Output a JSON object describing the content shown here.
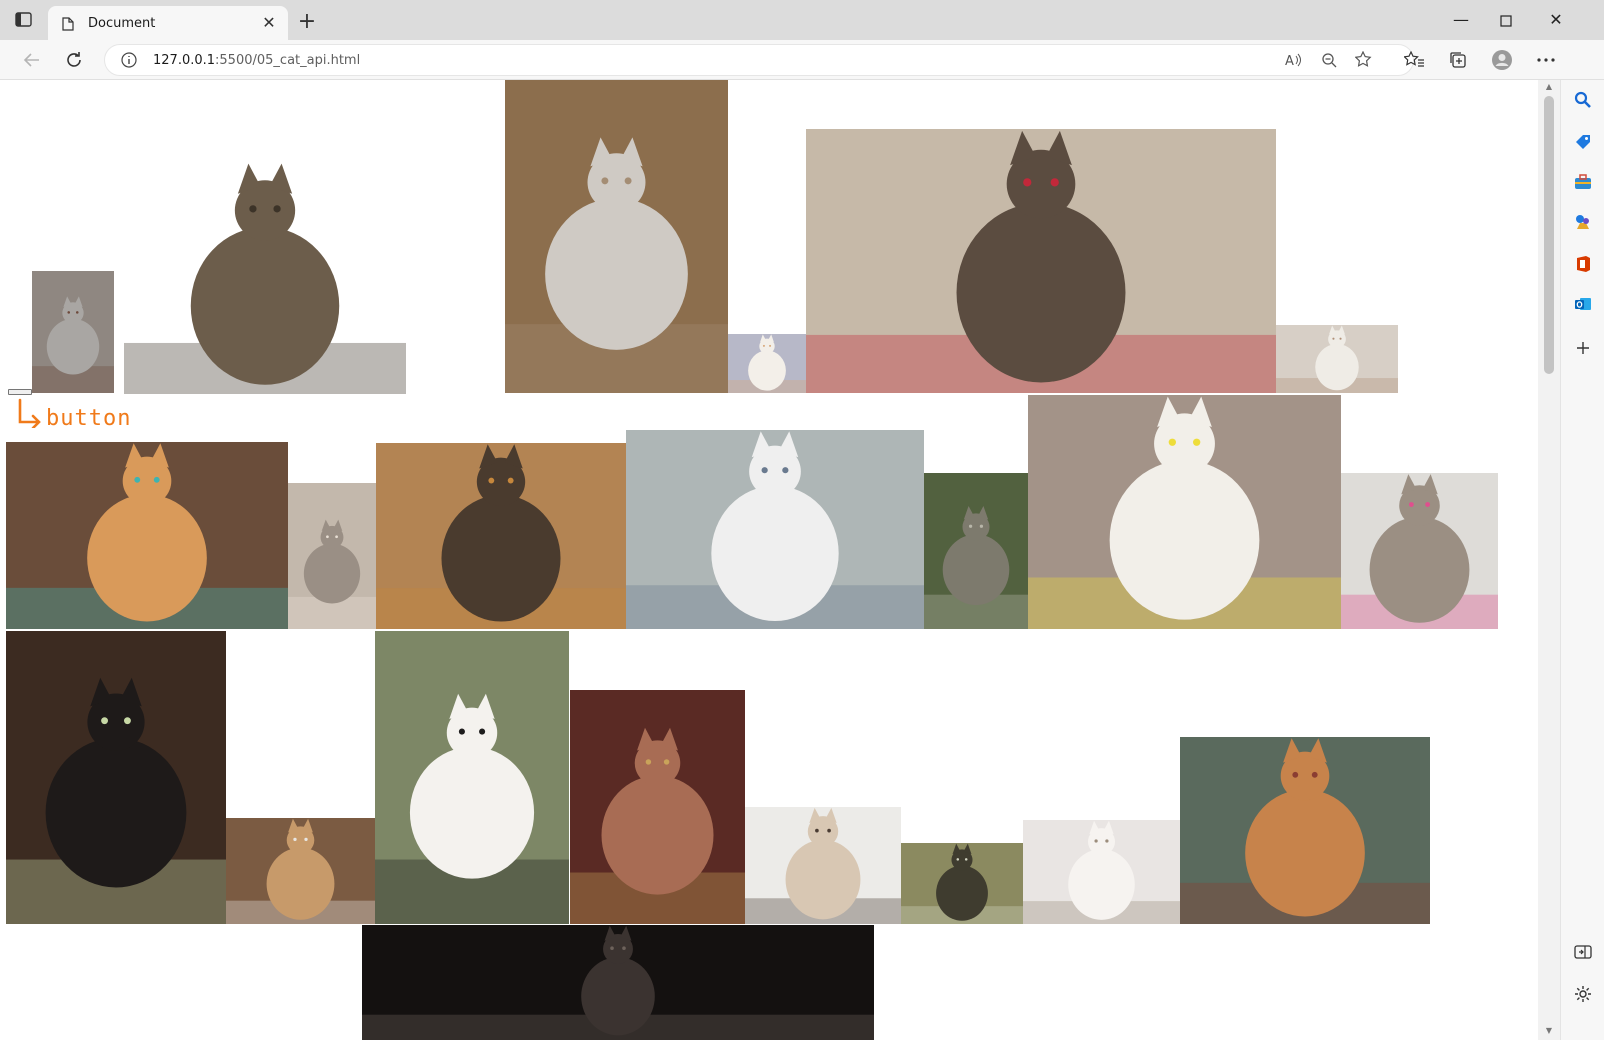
{
  "browser": {
    "tab_title": "Document",
    "url_host": "127.0.0.1",
    "url_path": ":5500/05_cat_api.html"
  },
  "page": {
    "button_annotation": "button",
    "annotation_color": "#f07a1a"
  },
  "cats": [
    {
      "name": "cat-photo-kitten-grey",
      "bg": "#8f8781",
      "body": "#a9a6a3",
      "accent": "#6e4a3c"
    },
    {
      "name": "cat-photo-tabby-sitting",
      "bg": "#ffffff",
      "body": "#6c5d4b",
      "accent": "#3c3328"
    },
    {
      "name": "cat-photo-fluffy-grey",
      "bg": "#8c6e4d",
      "body": "#cfcac4",
      "accent": "#a48d74"
    },
    {
      "name": "cat-photo-small-white",
      "bg": "#b7b8c8",
      "body": "#f3efe9",
      "accent": "#d7a77a"
    },
    {
      "name": "cat-photo-curly-brown",
      "bg": "#c6b9a8",
      "body": "#5b4c40",
      "accent": "#c2283a"
    },
    {
      "name": "cat-photo-room-small",
      "bg": "#d7cfc6",
      "body": "#efece6",
      "accent": "#b09078"
    },
    {
      "name": "cat-photo-orange-basket",
      "bg": "#6a4d3a",
      "body": "#d99a5a",
      "accent": "#3fb3b0"
    },
    {
      "name": "cat-photo-grey-floor",
      "bg": "#c3b8ac",
      "body": "#9a8f85",
      "accent": "#e7ded3"
    },
    {
      "name": "cat-photo-breadbox",
      "bg": "#b38453",
      "body": "#4a3b2e",
      "accent": "#c6873c"
    },
    {
      "name": "cat-photo-pillow",
      "bg": "#aeb6b6",
      "body": "#efefef",
      "accent": "#6a7a8f"
    },
    {
      "name": "cat-photo-tree",
      "bg": "#52613f",
      "body": "#7d7a6d",
      "accent": "#b8b6a9"
    },
    {
      "name": "cat-photo-fluffy-sleeping",
      "bg": "#a39388",
      "body": "#f2efe9",
      "accent": "#eedd3a"
    },
    {
      "name": "cat-photo-party",
      "bg": "#dedcd8",
      "body": "#9b8f83",
      "accent": "#e04f8e"
    },
    {
      "name": "cat-photo-tuxedo-bowl",
      "bg": "#3c2b21",
      "body": "#1e1a19",
      "accent": "#c7d8a5"
    },
    {
      "name": "cat-photo-dog-and-cat",
      "bg": "#7b5b42",
      "body": "#c79a6a",
      "accent": "#e9e6e1"
    },
    {
      "name": "cat-photo-bw-grass",
      "bg": "#7d8766",
      "body": "#f4f2ee",
      "accent": "#1e1d1d"
    },
    {
      "name": "cat-photo-calico-bed",
      "bg": "#5a2a24",
      "body": "#a86c54",
      "accent": "#c9a35a"
    },
    {
      "name": "cat-photo-siamese",
      "bg": "#ecebe8",
      "body": "#d8c7b3",
      "accent": "#4a3c33"
    },
    {
      "name": "cat-photo-window",
      "bg": "#8b8a60",
      "body": "#3f3c2f",
      "accent": "#d4d6c4"
    },
    {
      "name": "cat-photo-white-sleeping",
      "bg": "#e9e5e3",
      "body": "#f6f3f0",
      "accent": "#9c8d7c"
    },
    {
      "name": "cat-photo-orange-couch",
      "bg": "#5a6a5d",
      "body": "#c7834b",
      "accent": "#8b3d32"
    },
    {
      "name": "cat-photo-dark-closeup",
      "bg": "#141110",
      "body": "#3b3330",
      "accent": "#6d625b"
    }
  ]
}
